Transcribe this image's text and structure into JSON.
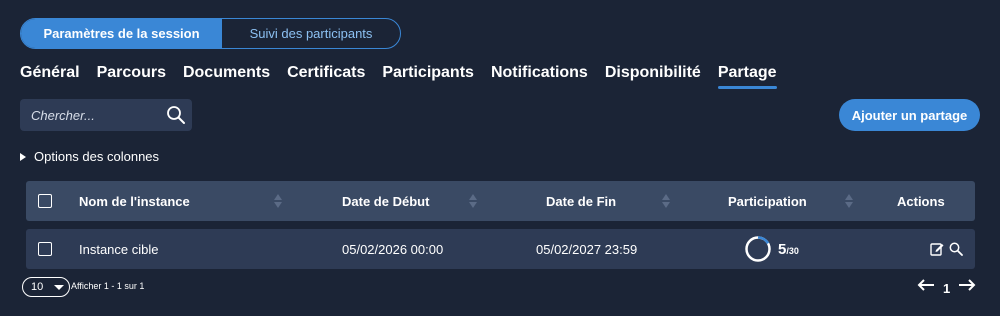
{
  "segments": {
    "active": "Paramètres de la session",
    "inactive": "Suivi des participants"
  },
  "tabs": [
    {
      "label": "Général"
    },
    {
      "label": "Parcours"
    },
    {
      "label": "Documents"
    },
    {
      "label": "Certificats"
    },
    {
      "label": "Participants"
    },
    {
      "label": "Notifications"
    },
    {
      "label": "Disponibilité"
    },
    {
      "label": "Partage",
      "active": true
    }
  ],
  "search": {
    "placeholder": "Chercher..."
  },
  "add_button": "Ajouter un partage",
  "column_options": "Options des colonnes",
  "table": {
    "headers": {
      "name": "Nom de l'instance",
      "start": "Date de Début",
      "end": "Date de Fin",
      "participation": "Participation",
      "actions": "Actions"
    },
    "rows": [
      {
        "name": "Instance cible",
        "start": "05/02/2026 00:00",
        "end": "05/02/2027 23:59",
        "participation_value": "5",
        "participation_total": "/30",
        "participation_fraction": 0.167
      }
    ]
  },
  "footer": {
    "page_size": "10",
    "showing": "Afficher 1 - 1 sur 1",
    "current_page": "1"
  },
  "colors": {
    "accent": "#3a87d6",
    "background": "#1b2436",
    "header_row": "#3a4a64",
    "row": "#2e3b55"
  },
  "icons": [
    "search-icon",
    "edit-icon",
    "magnifier-icon",
    "arrow-left-icon",
    "arrow-right-icon",
    "caret-down-icon",
    "triangle-right-icon"
  ]
}
